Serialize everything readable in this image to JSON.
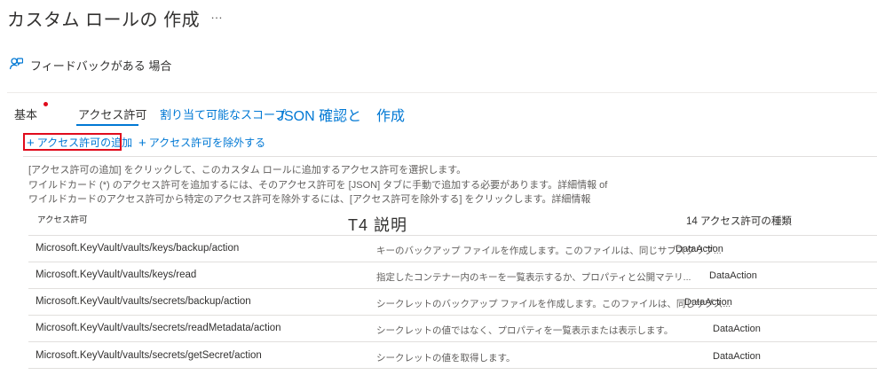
{
  "header": {
    "title": "カスタム ロールの 作成",
    "more_label": "…"
  },
  "feedback": {
    "label": "フィードバックがある 場合"
  },
  "tabs": [
    {
      "label": "基本"
    },
    {
      "label": "アクセス許可"
    },
    {
      "label": "割り当て可能なスコープ"
    },
    {
      "label": "JSON 確認と"
    },
    {
      "label": "作成"
    }
  ],
  "commands": {
    "add": "アクセス許可の追加",
    "exclude": "アクセス許可を除外する"
  },
  "info_lines": [
    "[アクセス許可の追加] をクリックして、このカスタム ロールに追加するアクセス許可を選択します。",
    "ワイルドカード (*) のアクセス許可を追加するには、そのアクセス許可を [JSON] タブに手動で追加する必要があります。詳細情報 of",
    "ワイルドカードのアクセス許可から特定のアクセス許可を除外するには、[アクセス許可を除外する] をクリックします。詳細情報"
  ],
  "table": {
    "headers": {
      "permission": "アクセス許可",
      "description": "T4 説明",
      "count": "14 アクセス許可の種類"
    },
    "rows": [
      {
        "permission": "Microsoft.KeyVault/vaults/keys/backup/action",
        "description": "キーのバックアップ ファイルを作成します。このファイルは、同じサブスクリプ...",
        "type": "DataAction"
      },
      {
        "permission": "Microsoft.KeyVault/vaults/keys/read",
        "description": "指定したコンテナー内のキーを一覧表示するか、プロパティと公開マテリ...",
        "type": "DataAction"
      },
      {
        "permission": "Microsoft.KeyVault/vaults/secrets/backup/action",
        "description": "シークレットのバックアップ ファイルを作成します。このファイルは、同じサブス...",
        "type": "DataAction"
      },
      {
        "permission": "Microsoft.KeyVault/vaults/secrets/readMetadata/action",
        "description": "シークレットの値ではなく、プロパティを一覧表示または表示します。",
        "type": "DataAction"
      },
      {
        "permission": "Microsoft.KeyVault/vaults/secrets/getSecret/action",
        "description": "シークレットの値を取得します。",
        "type": "DataAction"
      }
    ]
  },
  "colors": {
    "accent": "#0078d4",
    "required": "#e00b1c",
    "highlight_box": "#e00b1c"
  }
}
